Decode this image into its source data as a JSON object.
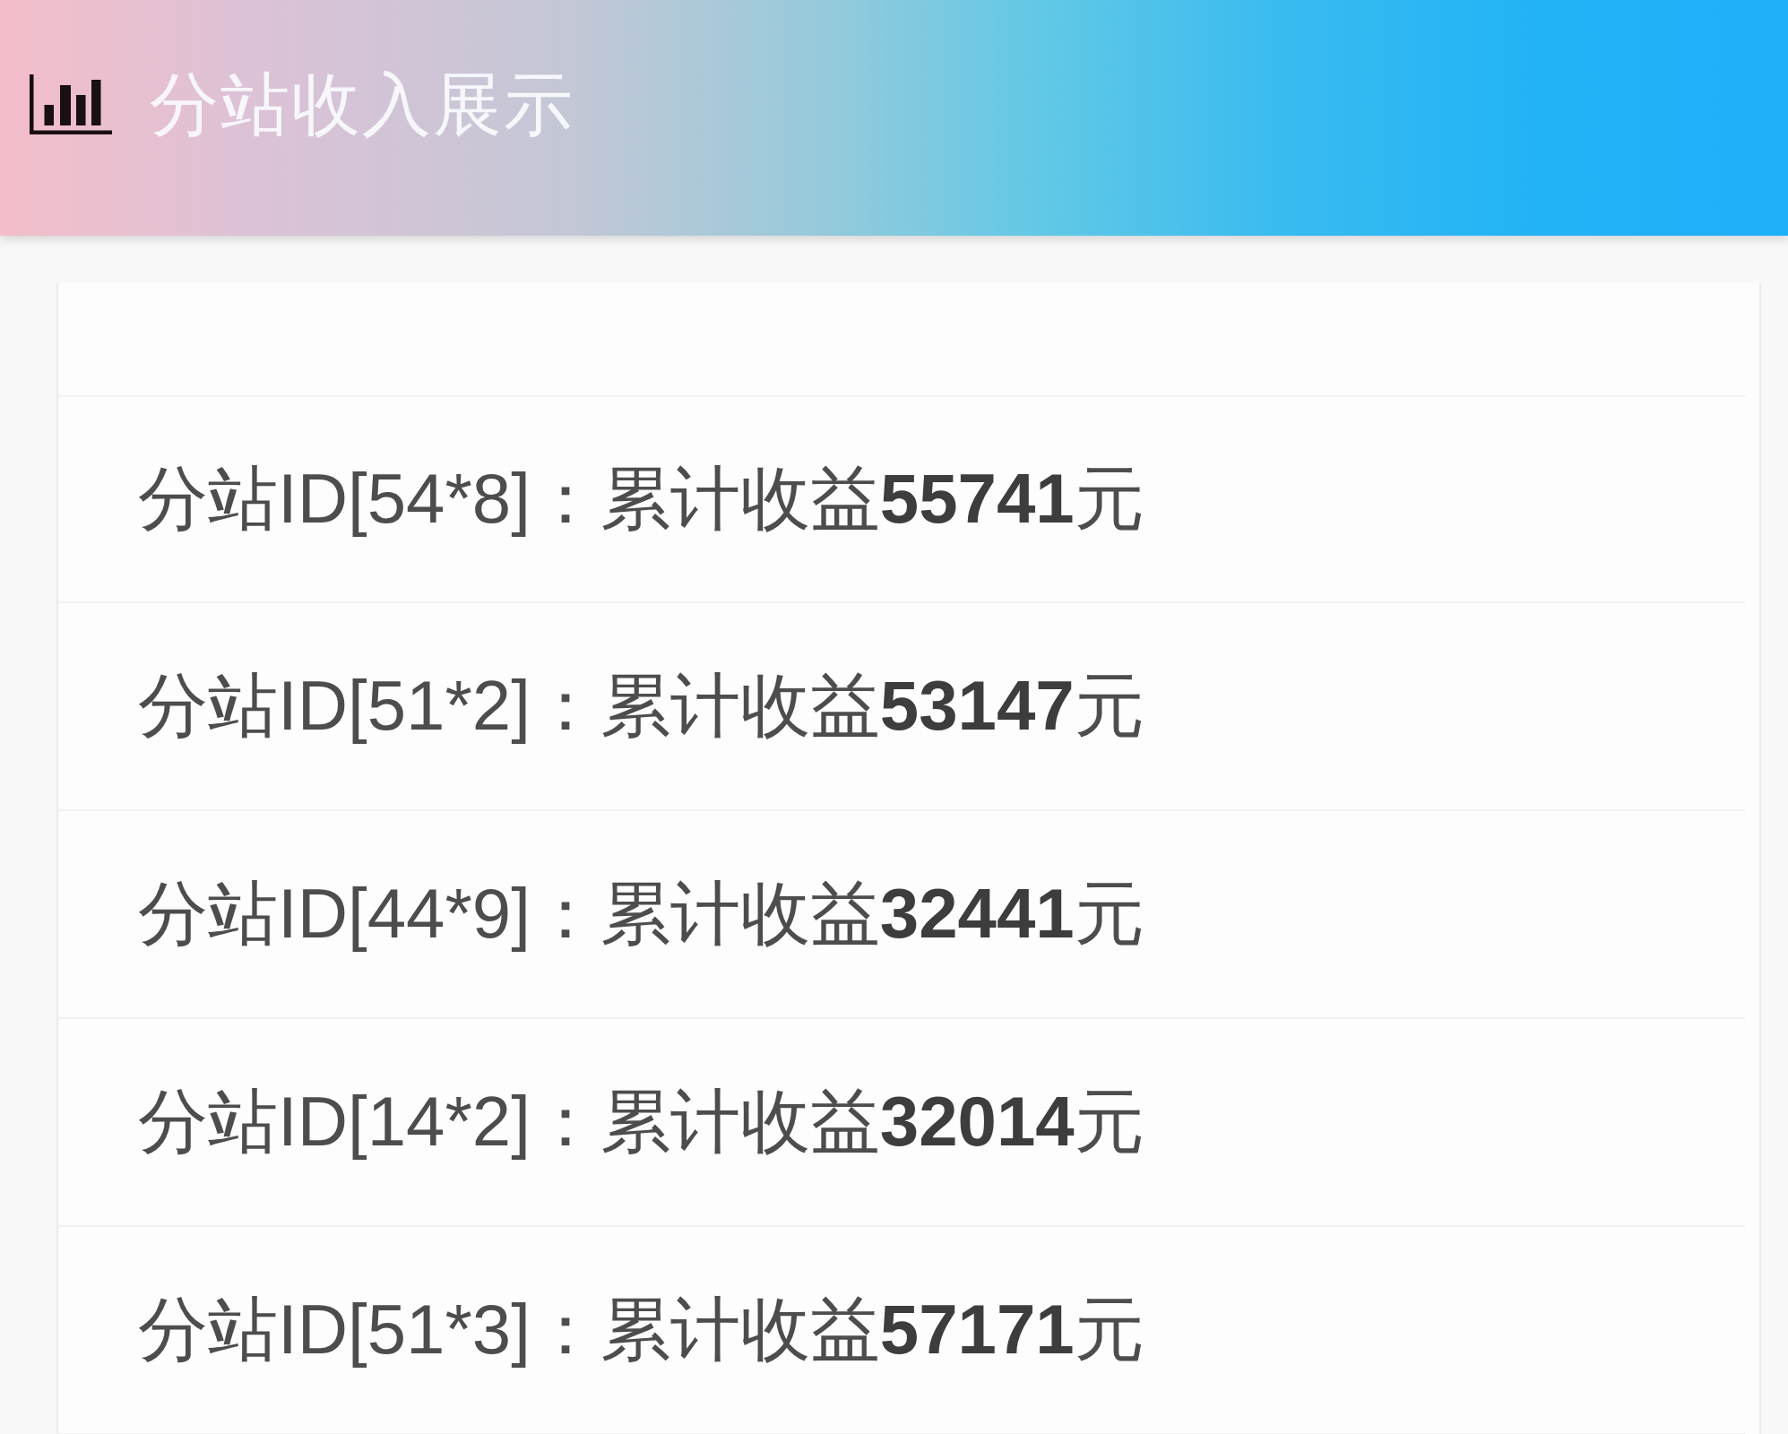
{
  "header": {
    "title": "分站收入展示"
  },
  "rows": [
    {
      "text": "分站ID[54*8]：累计收益**55741**元"
    },
    {
      "text": "分站ID[51*2]：累计收益**53147**元"
    },
    {
      "text": "分站ID[44*9]：累计收益**32441**元"
    },
    {
      "text": "分站ID[14*2]：累计收益**32014**元"
    },
    {
      "text": "分站ID[51*3]：累计收益**57171**元"
    }
  ]
}
